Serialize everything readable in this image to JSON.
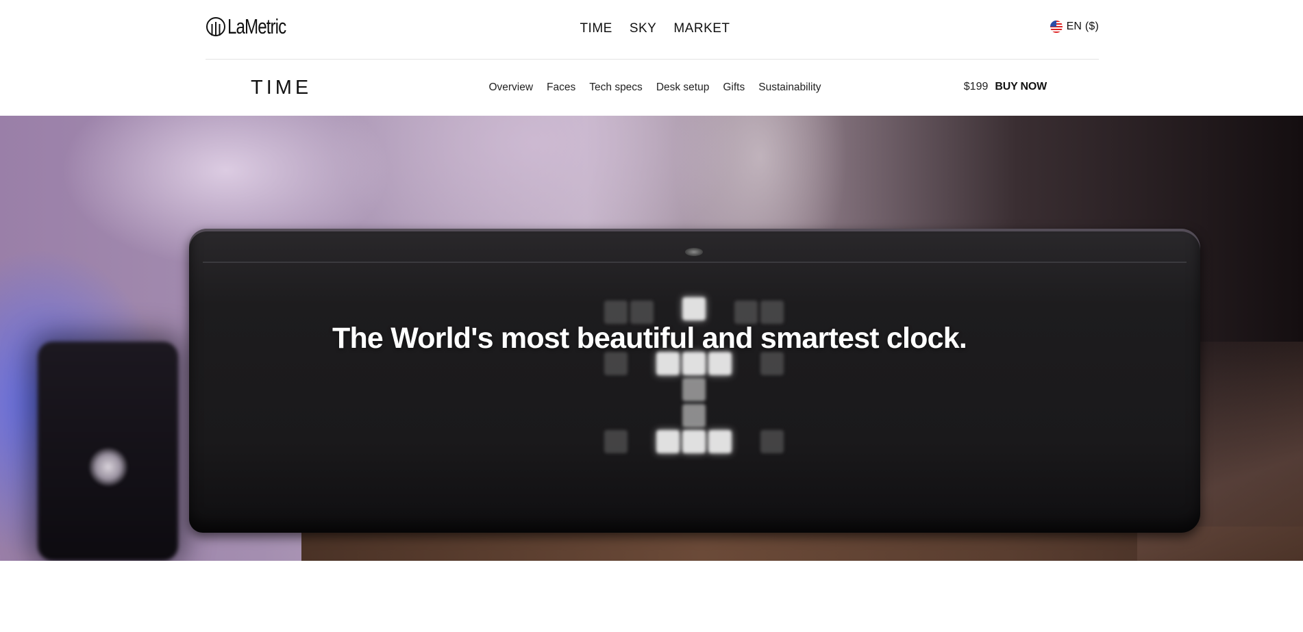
{
  "header": {
    "logo_text": "LaMetric",
    "nav": [
      "TIME",
      "SKY",
      "MARKET"
    ],
    "language": "EN ($)"
  },
  "subnav": {
    "product_title": "TIME",
    "sections": [
      "Overview",
      "Faces",
      "Tech specs",
      "Desk setup",
      "Gifts",
      "Sustainability"
    ],
    "price": "$199",
    "buy_label": "BUY NOW"
  },
  "hero": {
    "headline": "The World's most beautiful and smartest clock.",
    "display_icon": "pixel-hourglass-icon"
  },
  "colors": {
    "background": "#ffffff",
    "text": "#111111",
    "divider": "#e3e3e3",
    "hero_headline": "#ffffff"
  }
}
